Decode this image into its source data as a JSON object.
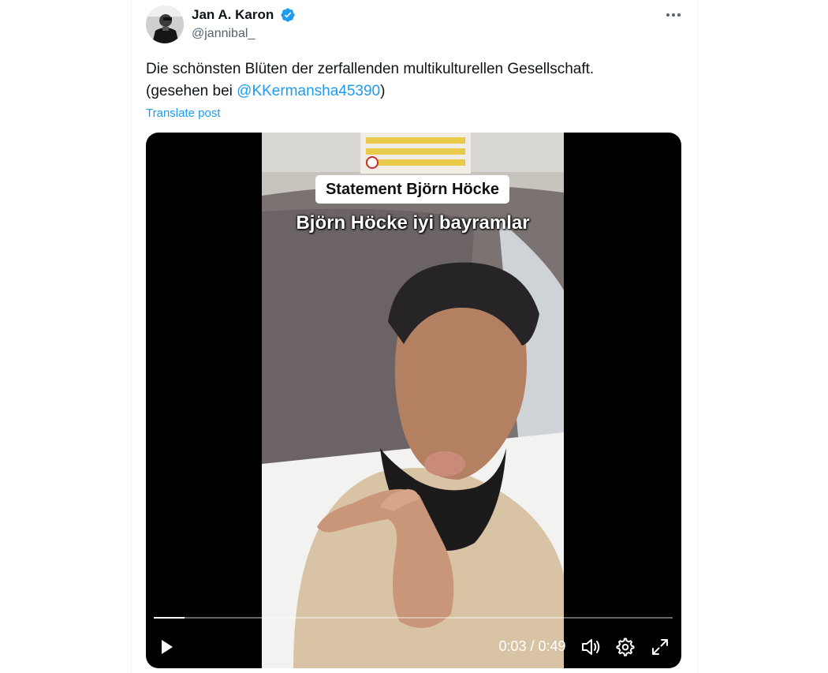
{
  "tweet": {
    "author": {
      "display_name": "Jan A. Karon",
      "handle": "@jannibal_",
      "verified": true
    },
    "text_line1": "Die schönsten Blüten der zerfallenden multikulturellen Gesellschaft.",
    "text_line2_prefix": "(gesehen bei ",
    "mention": "@KKermansha45390",
    "text_line2_suffix": ")",
    "translate_label": "Translate post"
  },
  "video": {
    "caption_box": "Statement Björn Höcke",
    "caption_subtitle": "Björn Höcke iyi bayramlar",
    "current_time": "0:03",
    "duration": "0:49",
    "time_display": "0:03 / 0:49",
    "progress_fraction": 0.06
  },
  "icons": {
    "more": "more-horizontal-icon",
    "verified": "verified-badge-icon",
    "play": "play-icon",
    "volume": "volume-icon",
    "settings": "gear-icon",
    "fullscreen": "fullscreen-icon"
  },
  "colors": {
    "accent": "#1d9bf0",
    "text": "#0f1419",
    "secondary": "#536471",
    "video_bg": "#000000"
  }
}
